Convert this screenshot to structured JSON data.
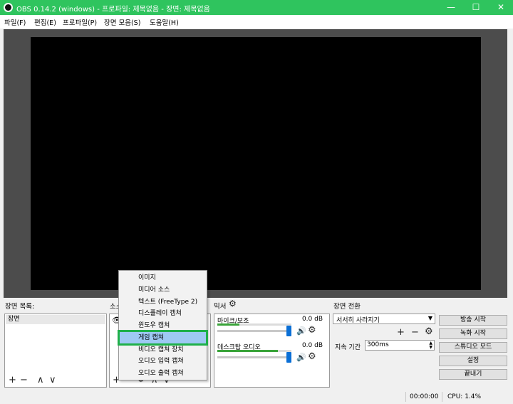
{
  "window": {
    "title": "OBS 0.14.2 (windows) - 프로파일: 제목없음 - 장면: 제목없음",
    "minimize": "—",
    "maximize": "☐",
    "close": "✕"
  },
  "menubar": {
    "items": [
      "파일(F)",
      "편집(E)",
      "프로파일(P)",
      "장면 모음(S)",
      "도움말(H)"
    ]
  },
  "scenes": {
    "title": "장면 목록:",
    "items": [
      "장면"
    ],
    "add": "+",
    "remove": "−",
    "up": "∧",
    "down": "∨"
  },
  "sources": {
    "title": "소스",
    "add": "+",
    "remove": "−",
    "up": "∧",
    "down": "∨"
  },
  "context_menu": {
    "items": [
      "이미지",
      "미디어 소스",
      "텍스트 (FreeType 2)",
      "디스플레이 캡쳐",
      "윈도우 캡쳐",
      "게임 캡쳐",
      "비디오 캡쳐 장치",
      "오디오 입력 캡쳐",
      "오디오 출력 캡쳐"
    ],
    "highlighted": "게임 캡쳐"
  },
  "mixer": {
    "title": "믹서",
    "tracks": [
      {
        "name": "마이크/보조",
        "db": "0.0 dB",
        "level": 0.3
      },
      {
        "name": "데스크탑 오디오",
        "db": "0.0 dB",
        "level": 0.82
      }
    ]
  },
  "transitions": {
    "title": "장면 전환",
    "selected": "서서히 사라지기",
    "add": "+",
    "remove": "−",
    "duration_label": "지속 기간",
    "duration_value": "300ms"
  },
  "controls": {
    "start_streaming": "방송 시작",
    "start_recording": "녹화 시작",
    "studio_mode": "스튜디오 모드",
    "settings": "설정",
    "exit": "끝내기"
  },
  "status": {
    "time": "00:00:00",
    "cpu": "CPU: 1.4%"
  },
  "colors": {
    "titlebar": "#2fc45e",
    "highlight": "#9ec9f3",
    "highlight_outline": "#1fb04a",
    "fader": "#0a6fd6",
    "meter": "#3aa43a"
  }
}
